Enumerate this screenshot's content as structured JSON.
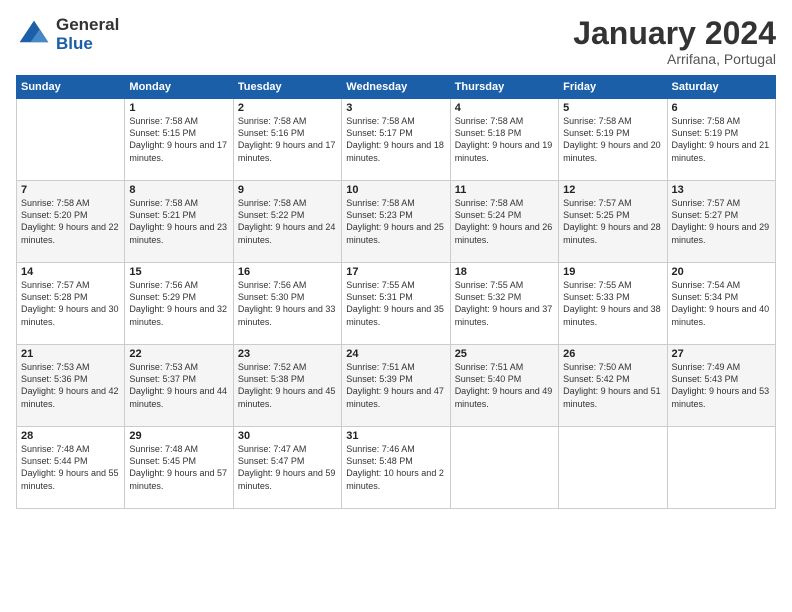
{
  "logo": {
    "general": "General",
    "blue": "Blue"
  },
  "header": {
    "title": "January 2024",
    "subtitle": "Arrifana, Portugal"
  },
  "weekdays": [
    "Sunday",
    "Monday",
    "Tuesday",
    "Wednesday",
    "Thursday",
    "Friday",
    "Saturday"
  ],
  "weeks": [
    [
      {
        "day": "",
        "sunrise": "",
        "sunset": "",
        "daylight": ""
      },
      {
        "day": "1",
        "sunrise": "7:58 AM",
        "sunset": "5:15 PM",
        "daylight": "9 hours and 17 minutes."
      },
      {
        "day": "2",
        "sunrise": "7:58 AM",
        "sunset": "5:16 PM",
        "daylight": "9 hours and 17 minutes."
      },
      {
        "day": "3",
        "sunrise": "7:58 AM",
        "sunset": "5:17 PM",
        "daylight": "9 hours and 18 minutes."
      },
      {
        "day": "4",
        "sunrise": "7:58 AM",
        "sunset": "5:18 PM",
        "daylight": "9 hours and 19 minutes."
      },
      {
        "day": "5",
        "sunrise": "7:58 AM",
        "sunset": "5:19 PM",
        "daylight": "9 hours and 20 minutes."
      },
      {
        "day": "6",
        "sunrise": "7:58 AM",
        "sunset": "5:19 PM",
        "daylight": "9 hours and 21 minutes."
      }
    ],
    [
      {
        "day": "7",
        "sunrise": "7:58 AM",
        "sunset": "5:20 PM",
        "daylight": "9 hours and 22 minutes."
      },
      {
        "day": "8",
        "sunrise": "7:58 AM",
        "sunset": "5:21 PM",
        "daylight": "9 hours and 23 minutes."
      },
      {
        "day": "9",
        "sunrise": "7:58 AM",
        "sunset": "5:22 PM",
        "daylight": "9 hours and 24 minutes."
      },
      {
        "day": "10",
        "sunrise": "7:58 AM",
        "sunset": "5:23 PM",
        "daylight": "9 hours and 25 minutes."
      },
      {
        "day": "11",
        "sunrise": "7:58 AM",
        "sunset": "5:24 PM",
        "daylight": "9 hours and 26 minutes."
      },
      {
        "day": "12",
        "sunrise": "7:57 AM",
        "sunset": "5:25 PM",
        "daylight": "9 hours and 28 minutes."
      },
      {
        "day": "13",
        "sunrise": "7:57 AM",
        "sunset": "5:27 PM",
        "daylight": "9 hours and 29 minutes."
      }
    ],
    [
      {
        "day": "14",
        "sunrise": "7:57 AM",
        "sunset": "5:28 PM",
        "daylight": "9 hours and 30 minutes."
      },
      {
        "day": "15",
        "sunrise": "7:56 AM",
        "sunset": "5:29 PM",
        "daylight": "9 hours and 32 minutes."
      },
      {
        "day": "16",
        "sunrise": "7:56 AM",
        "sunset": "5:30 PM",
        "daylight": "9 hours and 33 minutes."
      },
      {
        "day": "17",
        "sunrise": "7:55 AM",
        "sunset": "5:31 PM",
        "daylight": "9 hours and 35 minutes."
      },
      {
        "day": "18",
        "sunrise": "7:55 AM",
        "sunset": "5:32 PM",
        "daylight": "9 hours and 37 minutes."
      },
      {
        "day": "19",
        "sunrise": "7:55 AM",
        "sunset": "5:33 PM",
        "daylight": "9 hours and 38 minutes."
      },
      {
        "day": "20",
        "sunrise": "7:54 AM",
        "sunset": "5:34 PM",
        "daylight": "9 hours and 40 minutes."
      }
    ],
    [
      {
        "day": "21",
        "sunrise": "7:53 AM",
        "sunset": "5:36 PM",
        "daylight": "9 hours and 42 minutes."
      },
      {
        "day": "22",
        "sunrise": "7:53 AM",
        "sunset": "5:37 PM",
        "daylight": "9 hours and 44 minutes."
      },
      {
        "day": "23",
        "sunrise": "7:52 AM",
        "sunset": "5:38 PM",
        "daylight": "9 hours and 45 minutes."
      },
      {
        "day": "24",
        "sunrise": "7:51 AM",
        "sunset": "5:39 PM",
        "daylight": "9 hours and 47 minutes."
      },
      {
        "day": "25",
        "sunrise": "7:51 AM",
        "sunset": "5:40 PM",
        "daylight": "9 hours and 49 minutes."
      },
      {
        "day": "26",
        "sunrise": "7:50 AM",
        "sunset": "5:42 PM",
        "daylight": "9 hours and 51 minutes."
      },
      {
        "day": "27",
        "sunrise": "7:49 AM",
        "sunset": "5:43 PM",
        "daylight": "9 hours and 53 minutes."
      }
    ],
    [
      {
        "day": "28",
        "sunrise": "7:48 AM",
        "sunset": "5:44 PM",
        "daylight": "9 hours and 55 minutes."
      },
      {
        "day": "29",
        "sunrise": "7:48 AM",
        "sunset": "5:45 PM",
        "daylight": "9 hours and 57 minutes."
      },
      {
        "day": "30",
        "sunrise": "7:47 AM",
        "sunset": "5:47 PM",
        "daylight": "9 hours and 59 minutes."
      },
      {
        "day": "31",
        "sunrise": "7:46 AM",
        "sunset": "5:48 PM",
        "daylight": "10 hours and 2 minutes."
      },
      {
        "day": "",
        "sunrise": "",
        "sunset": "",
        "daylight": ""
      },
      {
        "day": "",
        "sunrise": "",
        "sunset": "",
        "daylight": ""
      },
      {
        "day": "",
        "sunrise": "",
        "sunset": "",
        "daylight": ""
      }
    ]
  ]
}
